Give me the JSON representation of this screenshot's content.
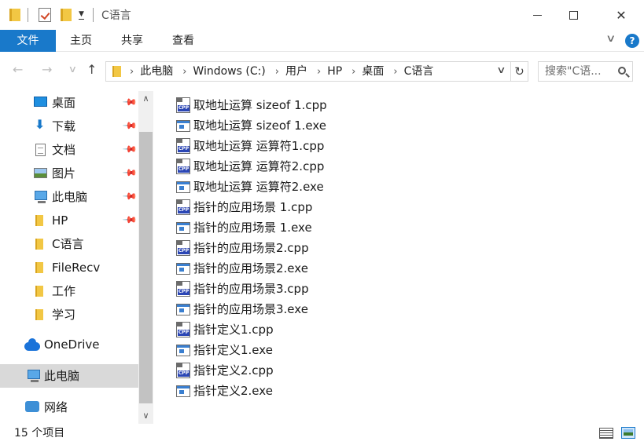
{
  "window": {
    "title": "C语言",
    "close_glyph": "✕"
  },
  "ribbon": {
    "tabs": [
      "文件",
      "主页",
      "共享",
      "查看"
    ],
    "collapse_glyph": "∨",
    "help_glyph": "?"
  },
  "nav": {
    "back_glyph": "←",
    "forward_glyph": "→",
    "recent_glyph": "∨",
    "up_glyph": "↑",
    "breadcrumb": [
      "此电脑",
      "Windows (C:)",
      "用户",
      "HP",
      "桌面",
      "C语言"
    ],
    "crumb_sep": "›",
    "dropdown_glyph": "∨",
    "refresh_glyph": "↻",
    "search_placeholder": "搜索\"C语..."
  },
  "sidebar": {
    "items": [
      {
        "label": "桌面",
        "icon": "desktop-icon",
        "pinned": true
      },
      {
        "label": "下载",
        "icon": "download-icon",
        "pinned": true
      },
      {
        "label": "文档",
        "icon": "documents-icon",
        "pinned": true
      },
      {
        "label": "图片",
        "icon": "pictures-icon",
        "pinned": true
      },
      {
        "label": "此电脑",
        "icon": "computer-icon",
        "pinned": true
      },
      {
        "label": "HP",
        "icon": "folder-icon",
        "pinned": true
      },
      {
        "label": "C语言",
        "icon": "folder-icon",
        "pinned": false
      },
      {
        "label": "FileRecv",
        "icon": "folder-icon",
        "pinned": false
      },
      {
        "label": "工作",
        "icon": "folder-icon",
        "pinned": false
      },
      {
        "label": "学习",
        "icon": "folder-icon",
        "pinned": false
      },
      {
        "label": "OneDrive",
        "icon": "onedrive-icon",
        "pinned": false
      },
      {
        "label": "此电脑",
        "icon": "computer-icon",
        "pinned": false,
        "selected": true
      },
      {
        "label": "网络",
        "icon": "network-icon",
        "pinned": false
      }
    ],
    "pin_glyph": "📌",
    "scroll_up_glyph": "∧",
    "scroll_down_glyph": "∨"
  },
  "files": [
    {
      "name": "取地址运算 sizeof 1.cpp",
      "type": "cpp"
    },
    {
      "name": "取地址运算 sizeof 1.exe",
      "type": "exe"
    },
    {
      "name": "取地址运算 运算符1.cpp",
      "type": "cpp"
    },
    {
      "name": "取地址运算 运算符2.cpp",
      "type": "cpp"
    },
    {
      "name": "取地址运算 运算符2.exe",
      "type": "exe"
    },
    {
      "name": "指针的应用场景 1.cpp",
      "type": "cpp"
    },
    {
      "name": "指针的应用场景 1.exe",
      "type": "exe"
    },
    {
      "name": "指针的应用场景2.cpp",
      "type": "cpp"
    },
    {
      "name": "指针的应用场景2.exe",
      "type": "exe"
    },
    {
      "name": "指针的应用场景3.cpp",
      "type": "cpp"
    },
    {
      "name": "指针的应用场景3.exe",
      "type": "exe"
    },
    {
      "name": "指针定义1.cpp",
      "type": "cpp"
    },
    {
      "name": "指针定义1.exe",
      "type": "exe"
    },
    {
      "name": "指针定义2.cpp",
      "type": "cpp"
    },
    {
      "name": "指针定义2.exe",
      "type": "exe"
    }
  ],
  "status": {
    "item_count": "15 个项目"
  },
  "colors": {
    "accent": "#1979ca",
    "selection": "#d9d9d9",
    "folder": "#f2c744"
  }
}
